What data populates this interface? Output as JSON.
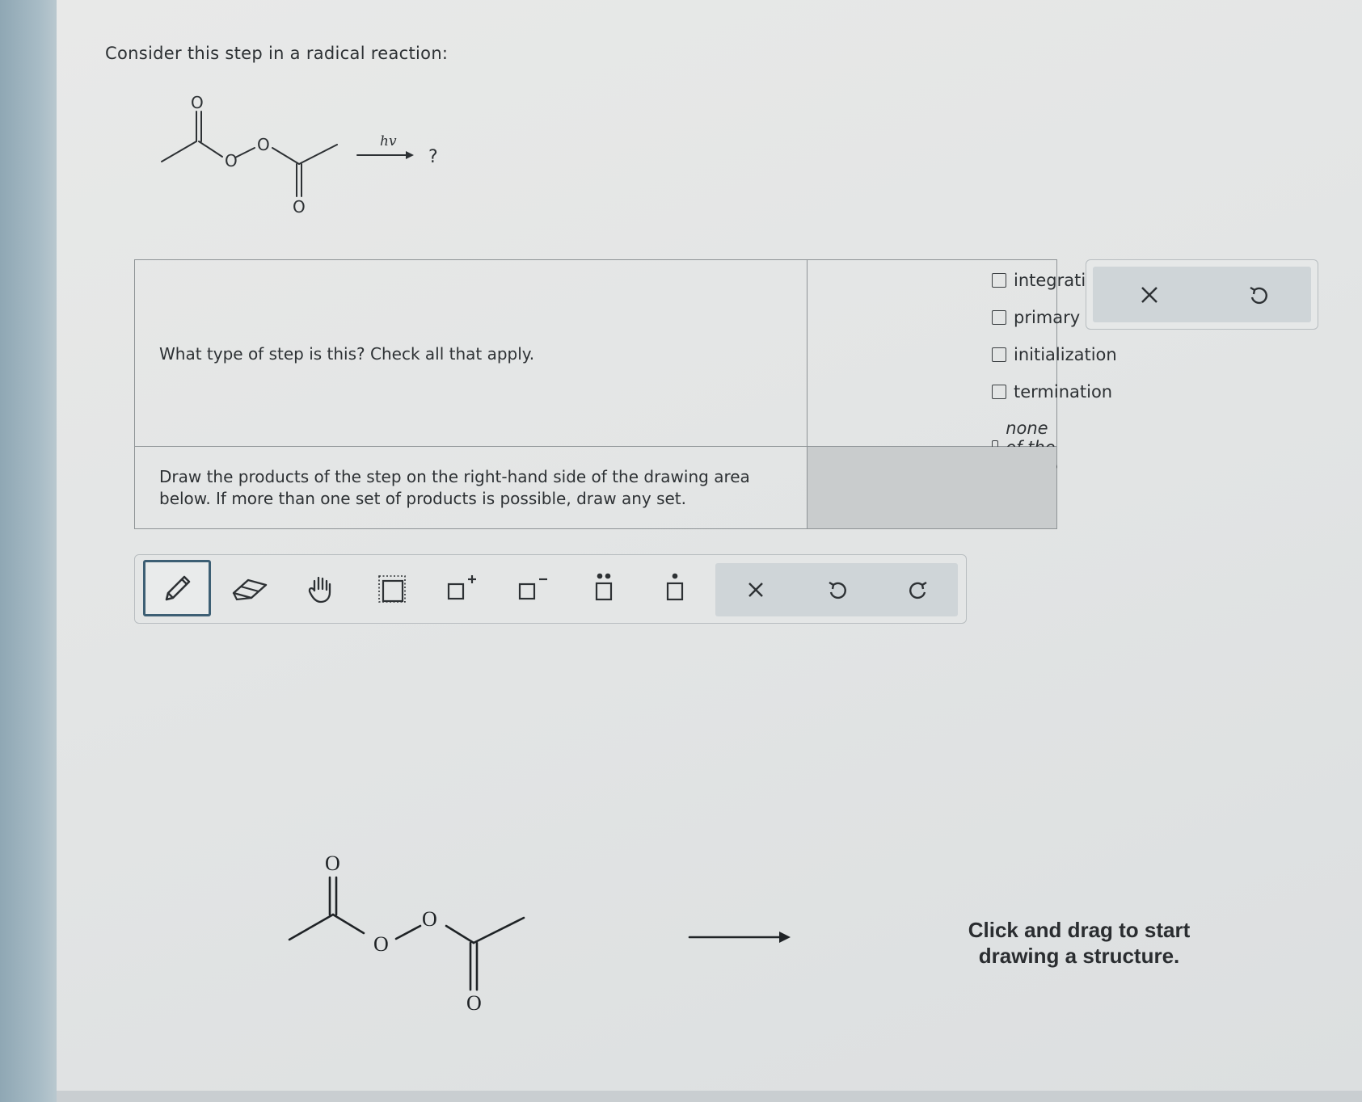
{
  "question": {
    "prompt": "Consider this step in a radical reaction:",
    "reaction": {
      "condition_label": "hv",
      "product_placeholder": "?",
      "reactant_atom_label": "O"
    }
  },
  "table": {
    "q1_text": "What type of step is this? Check all that apply.",
    "options": [
      {
        "label": "integration",
        "checked": false
      },
      {
        "label": "primary",
        "checked": false
      },
      {
        "label": "initialization",
        "checked": false
      },
      {
        "label": "termination",
        "checked": false
      },
      {
        "label": "none of the above",
        "checked": false
      }
    ],
    "q2_text": "Draw the products of the step on the right-hand side of the drawing area below. If more than one set of products is possible, draw any set."
  },
  "side_panel": {
    "buttons": [
      {
        "icon": "close-icon",
        "symbol": "×"
      },
      {
        "icon": "undo-icon",
        "symbol": "↶"
      }
    ]
  },
  "toolbar": {
    "tools": [
      {
        "icon": "pencil-icon",
        "selected": true
      },
      {
        "icon": "eraser-icon",
        "selected": false
      },
      {
        "icon": "hand-icon",
        "selected": false
      },
      {
        "icon": "selection-box-icon",
        "selected": false
      },
      {
        "icon": "positive-charge-icon",
        "charge": "+",
        "selected": false
      },
      {
        "icon": "negative-charge-icon",
        "charge": "−",
        "selected": false
      },
      {
        "icon": "lone-pair-icon",
        "selected": false
      },
      {
        "icon": "radical-icon",
        "selected": false
      }
    ],
    "actions": [
      {
        "icon": "clear-icon",
        "symbol": "×"
      },
      {
        "icon": "undo-icon",
        "symbol": "↶"
      },
      {
        "icon": "redo-icon",
        "symbol": "↷"
      }
    ]
  },
  "canvas": {
    "hint": "Click and drag to start drawing a structure.",
    "atom_label": "O"
  },
  "colors": {
    "left_bar": "#a8bcc6",
    "panel_grey": "#cfd5d8",
    "selected_border": "#3d5f74"
  }
}
